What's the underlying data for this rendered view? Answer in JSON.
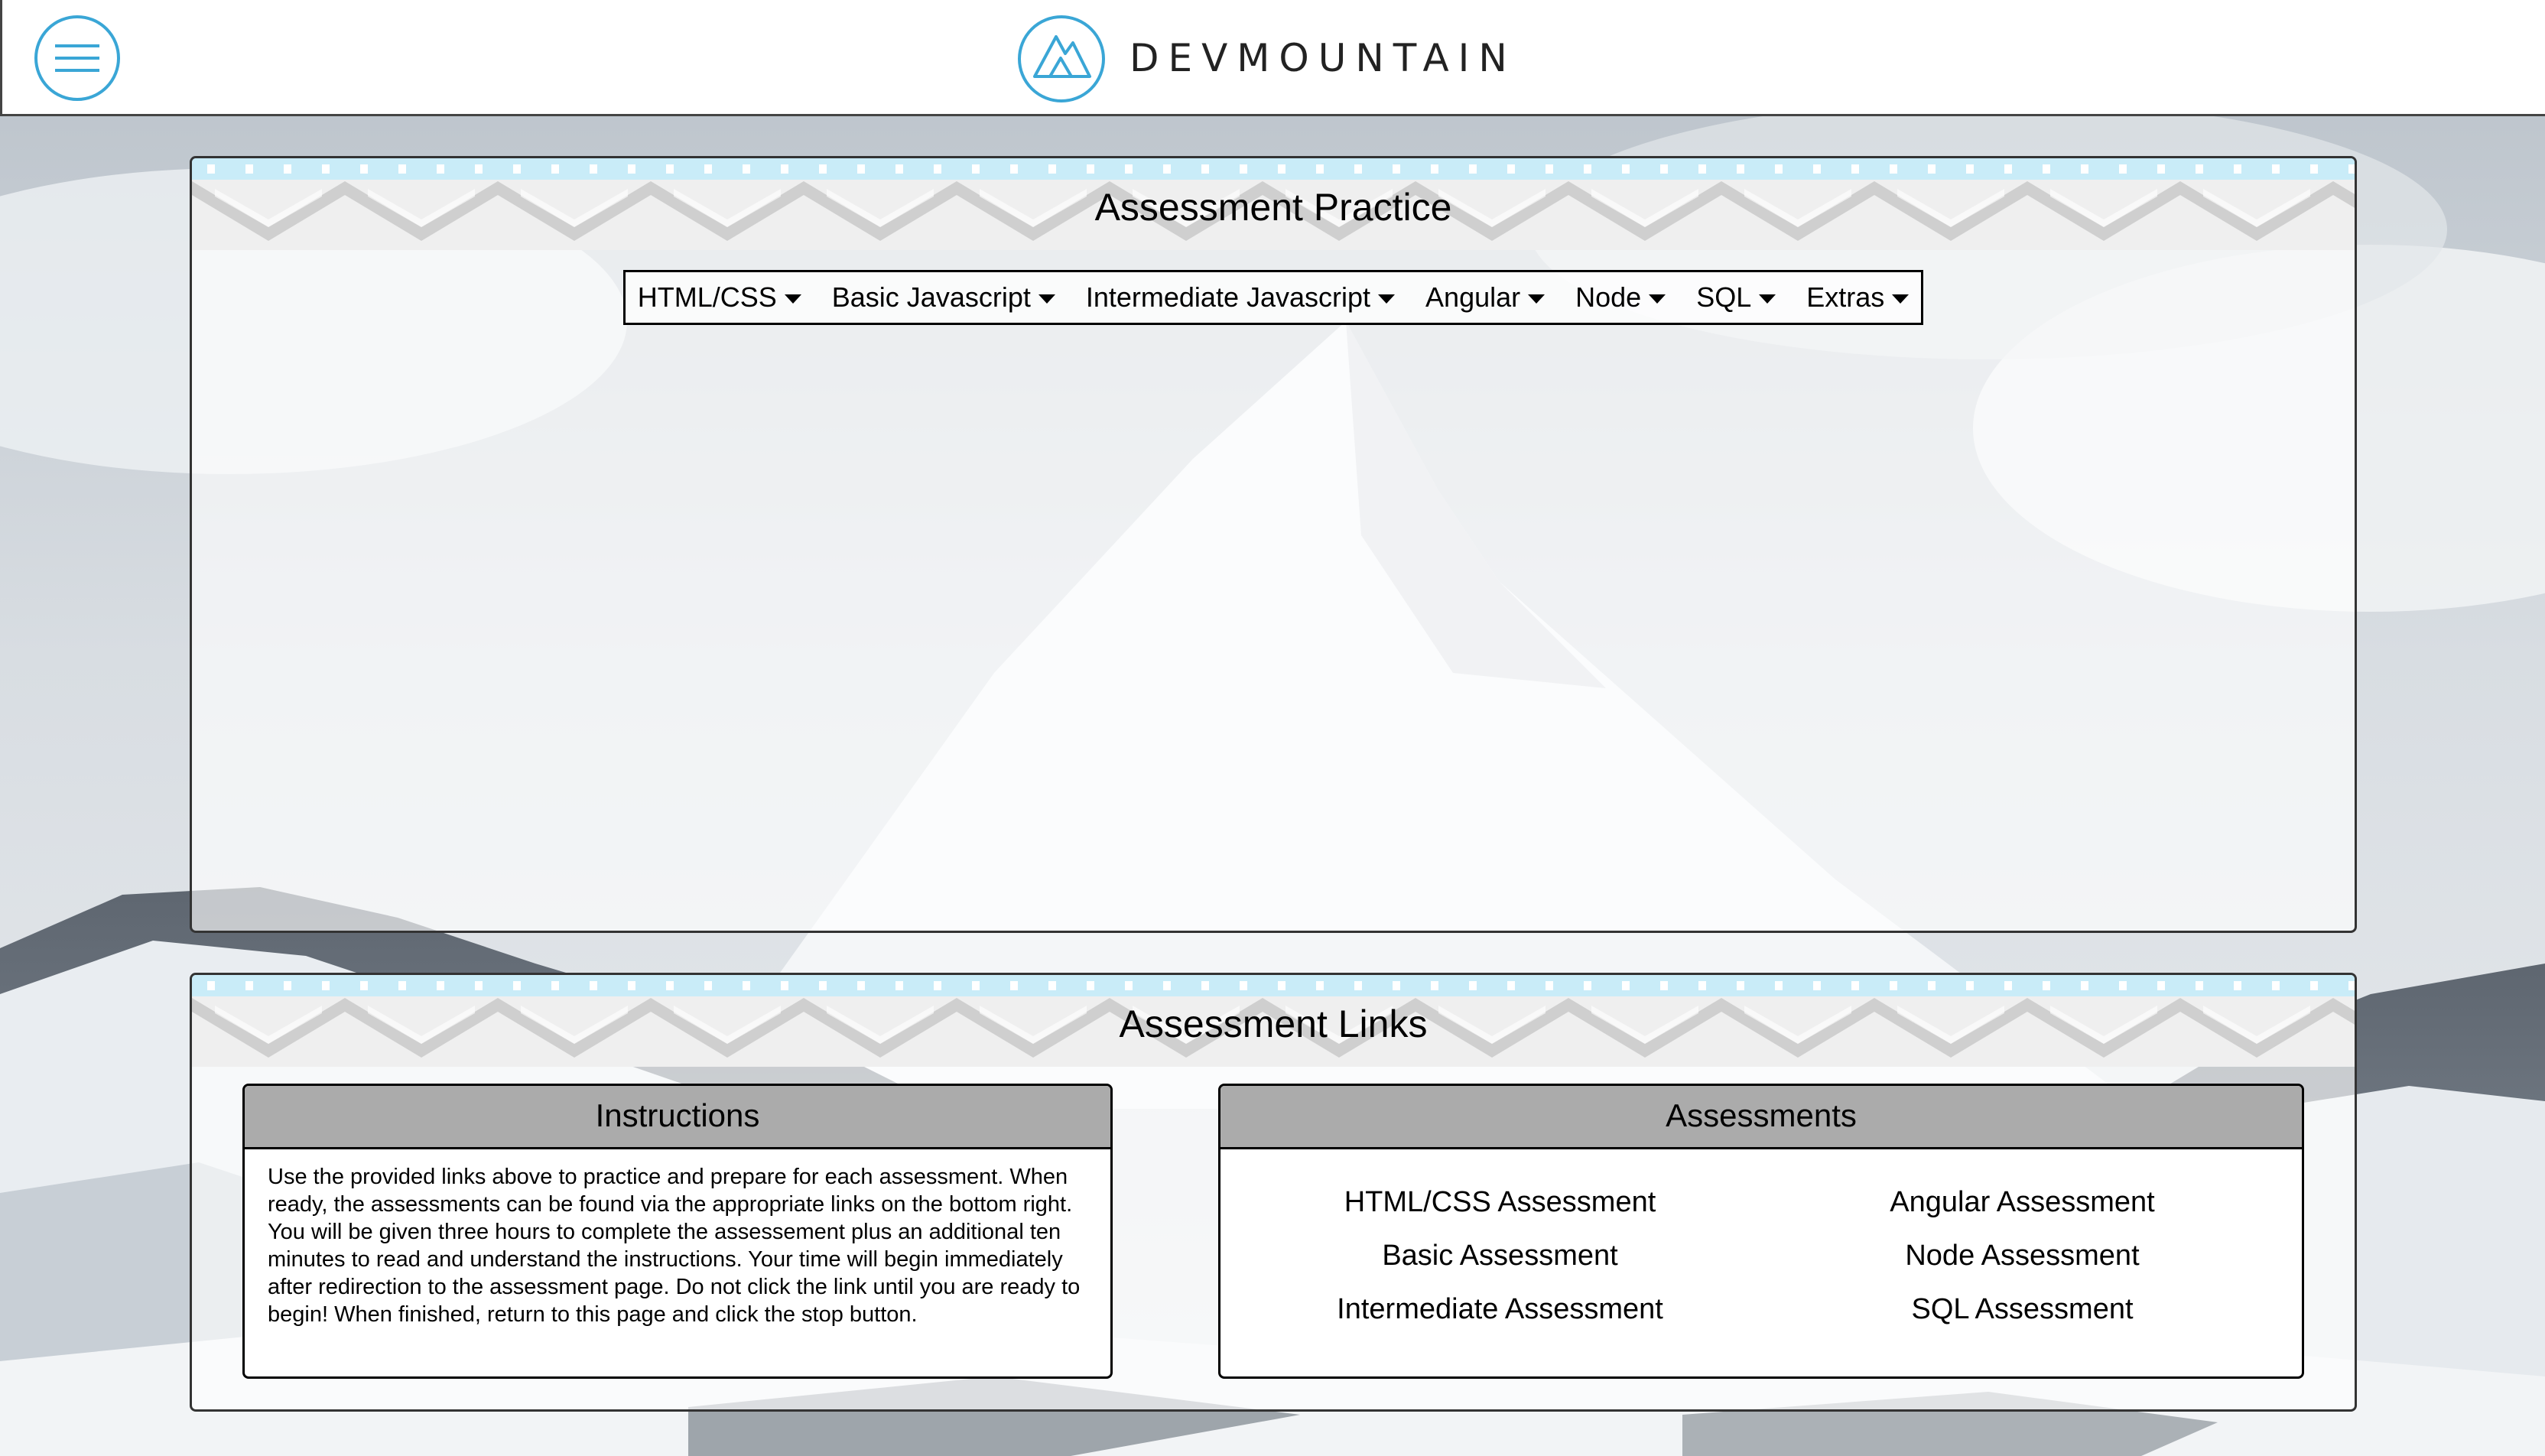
{
  "header": {
    "brand": "DEVMOUNTAIN",
    "menu_icon": "hamburger-menu-icon",
    "logo_icon": "mountain-logo-icon",
    "accent_color": "#3aa6d6"
  },
  "practice": {
    "title": "Assessment Practice",
    "nav": [
      {
        "label": "HTML/CSS"
      },
      {
        "label": "Basic Javascript"
      },
      {
        "label": "Intermediate Javascript"
      },
      {
        "label": "Angular"
      },
      {
        "label": "Node"
      },
      {
        "label": "SQL"
      },
      {
        "label": "Extras"
      }
    ]
  },
  "links": {
    "title": "Assessment Links",
    "instructions": {
      "heading": "Instructions",
      "text": "Use the provided links above to practice and prepare for each assessment. When ready, the assessments can be found via the appropriate links on the bottom right. You will be given three hours to complete the assessement plus an additional ten minutes to read and understand the instructions. Your time will begin immediately after redirection to the assessment page. Do not click the link until you are ready to begin! When finished, return to this page and click the stop button."
    },
    "assessments": {
      "heading": "Assessments",
      "items": [
        "HTML/CSS Assessment",
        "Angular Assessment",
        "Basic Assessment",
        "Node Assessment",
        "Intermediate Assessment",
        "SQL Assessment"
      ]
    }
  }
}
